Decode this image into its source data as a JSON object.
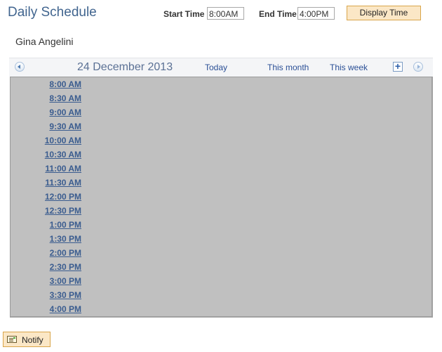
{
  "header": {
    "title": "Daily Schedule",
    "start_time_label": "Start Time",
    "start_time_value": "8:00AM",
    "end_time_label": "End Time",
    "end_time_value": "4:00PM",
    "display_button": "Display Time"
  },
  "person_name": "Gina Angelini",
  "navigation": {
    "prev_icon": "circle-arrow-left-icon",
    "date": "24 December 2013",
    "links": [
      "Today",
      "This month",
      "This week"
    ],
    "add_icon": "plus-icon",
    "next_icon": "circle-arrow-right-icon"
  },
  "time_slots": [
    "8:00 AM",
    "8:30 AM",
    "9:00 AM",
    "9:30 AM",
    "10:00 AM",
    "10:30 AM",
    "11:00 AM",
    "11:30 AM",
    "12:00 PM",
    "12:30 PM",
    "1:00 PM",
    "1:30 PM",
    "2:00 PM",
    "2:30 PM",
    "3:00 PM",
    "3:30 PM",
    "4:00 PM"
  ],
  "footer": {
    "notify_button": "Notify",
    "notify_icon": "notify-note-icon"
  },
  "colors": {
    "title": "#41658f",
    "link": "#2a4f96",
    "button_bg": "#fbe7c6",
    "button_border": "#d9a54a",
    "grid_bg": "#c0c0c0"
  }
}
